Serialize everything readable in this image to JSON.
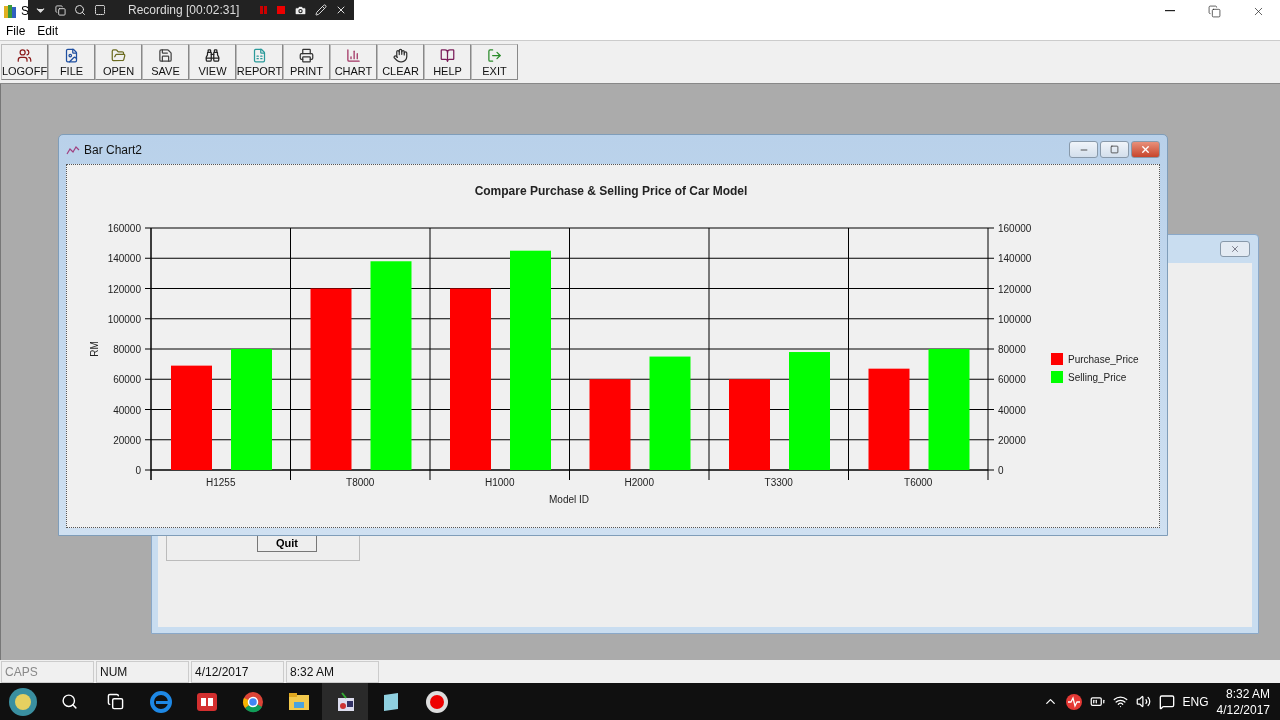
{
  "window": {
    "title": "S"
  },
  "recorder": {
    "label": "Recording [00:02:31]"
  },
  "menu": [
    "File",
    "Edit"
  ],
  "toolbar": [
    "LOGOFF",
    "FILE",
    "OPEN",
    "SAVE",
    "VIEW",
    "REPORT",
    "PRINT",
    "CHART",
    "CLEAR",
    "HELP",
    "EXIT"
  ],
  "back_window": {
    "button": "Quit"
  },
  "chart_window": {
    "title": "Bar Chart2",
    "chart_data": {
      "type": "bar",
      "title": "Compare Purchase & Selling Price of Car Model",
      "xlabel": "Model ID",
      "ylabel": "RM",
      "categories": [
        "H1255",
        "T8000",
        "H1000",
        "H2000",
        "T3300",
        "T6000"
      ],
      "series": [
        {
          "name": "Purchase_Price",
          "color": "#ff0000",
          "values": [
            69000,
            120000,
            120000,
            60000,
            60000,
            67000
          ]
        },
        {
          "name": "Selling_Price",
          "color": "#00ff00",
          "values": [
            80000,
            138000,
            145000,
            75000,
            78000,
            80000
          ]
        }
      ],
      "ylim": [
        0,
        160000
      ],
      "yticks": [
        0,
        20000,
        40000,
        60000,
        80000,
        100000,
        120000,
        140000,
        160000
      ],
      "y2ticks": [
        0,
        20000,
        40000,
        60000,
        80000,
        100000,
        120000,
        140000,
        160000
      ],
      "y2lim": [
        0,
        160000
      ],
      "grid": true,
      "legend": true
    }
  },
  "status_bar": [
    {
      "label": "CAPS",
      "on": false
    },
    {
      "label": "NUM",
      "on": true
    },
    {
      "label": "4/12/2017",
      "on": true
    },
    {
      "label": "8:32 AM",
      "on": true
    }
  ],
  "taskbar": {
    "language": "ENG",
    "time": "8:32 AM",
    "date": "4/12/2017"
  }
}
